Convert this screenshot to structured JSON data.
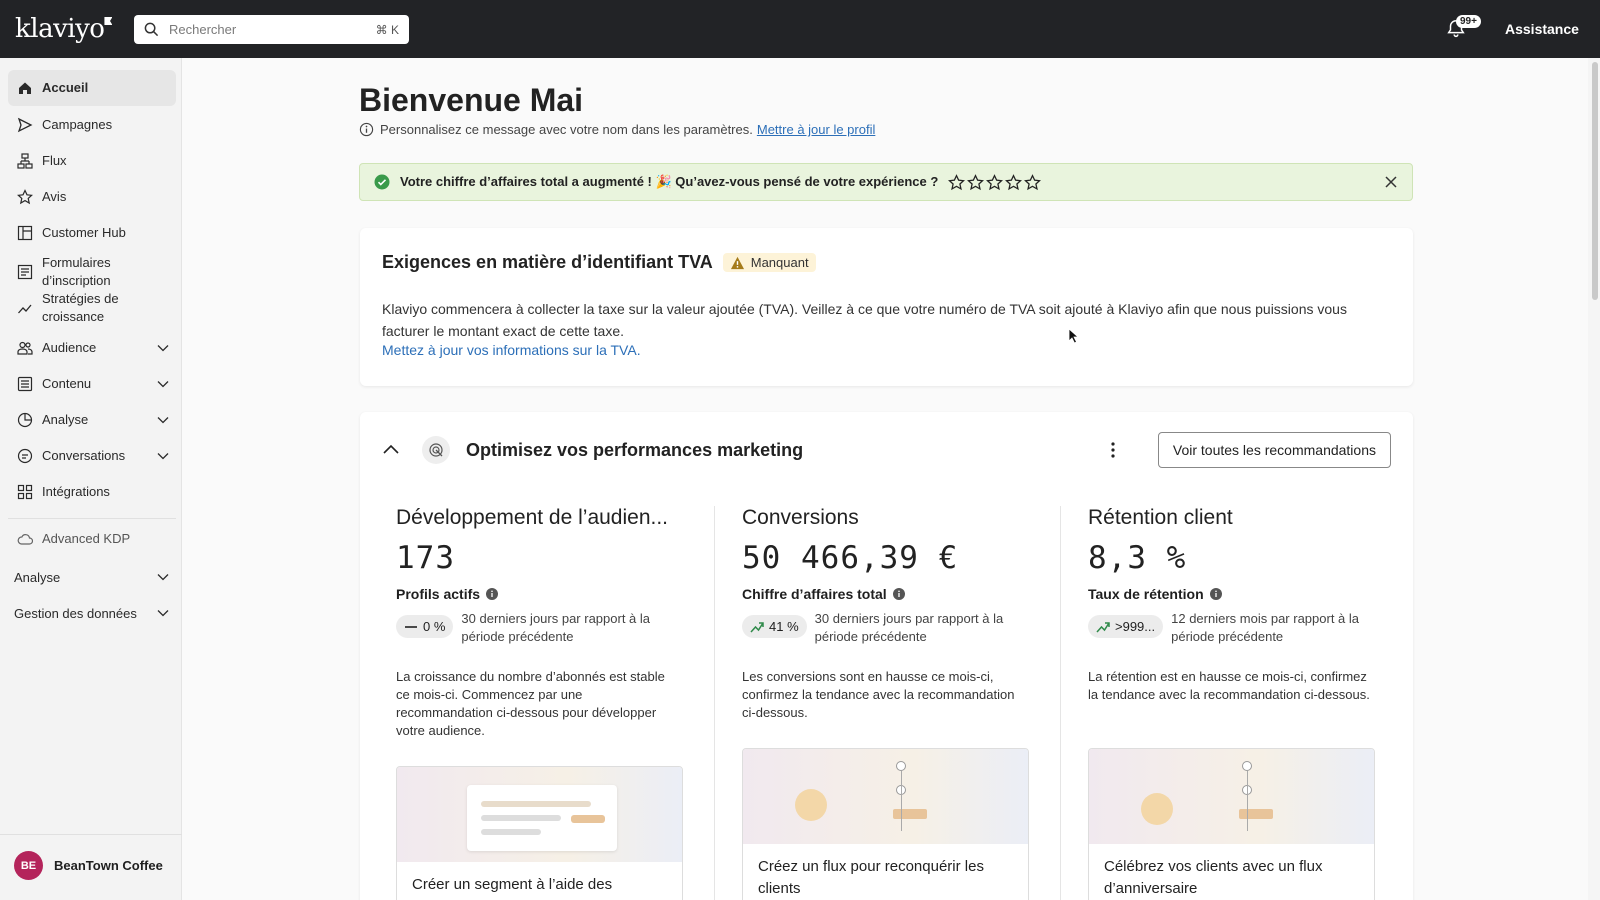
{
  "topbar": {
    "logo": "klaviyo",
    "search_placeholder": "Rechercher",
    "search_shortcut": "⌘ K",
    "notification_badge": "99+",
    "assistance_label": "Assistance"
  },
  "sidebar": {
    "items": [
      {
        "label": "Accueil",
        "icon": "home-icon",
        "active": true
      },
      {
        "label": "Campagnes",
        "icon": "send-icon"
      },
      {
        "label": "Flux",
        "icon": "flow-icon"
      },
      {
        "label": "Avis",
        "icon": "star-icon"
      },
      {
        "label": "Customer Hub",
        "icon": "hub-icon"
      },
      {
        "label": "Formulaires d’inscription",
        "icon": "form-icon"
      },
      {
        "label": "Stratégies de croissance",
        "icon": "growth-icon"
      },
      {
        "label": "Audience",
        "icon": "audience-icon",
        "expandable": true
      },
      {
        "label": "Contenu",
        "icon": "content-icon",
        "expandable": true
      },
      {
        "label": "Analyse",
        "icon": "analytics-icon",
        "expandable": true
      },
      {
        "label": "Conversations",
        "icon": "chat-icon",
        "expandable": true
      },
      {
        "label": "Intégrations",
        "icon": "grid-icon"
      }
    ],
    "advanced_kdp": "Advanced KDP",
    "section_analyse": "Analyse",
    "section_data": "Gestion des données",
    "account_initials": "BE",
    "account_name": "BeanTown Coffee"
  },
  "main": {
    "title": "Bienvenue Mai",
    "subtitle": "Personnalisez ce message avec votre nom dans les paramètres.",
    "subtitle_link": "Mettre à jour le profil",
    "alert_text": "Votre chiffre d’affaires total a augmenté ! 🎉 Qu’avez-vous pensé de votre expérience ?",
    "vat": {
      "title": "Exigences en matière d’identifiant TVA",
      "badge": "Manquant",
      "body": "Klaviyo commencera à collecter la taxe sur la valeur ajoutée (TVA). Veillez à ce que votre numéro de TVA soit ajouté à Klaviyo afin que nous puissions vous facturer le montant exact de cette taxe.",
      "link": "Mettez à jour vos informations sur la TVA."
    },
    "optimize": {
      "title": "Optimisez vos performances marketing",
      "button": "Voir toutes les recommandations",
      "columns": [
        {
          "heading": "Développement de l’audien...",
          "value": "173",
          "metric": "Profils actifs",
          "change": "0 %",
          "period": "30 derniers jours par rapport à la période précédente",
          "description": "La croissance du nombre d’abonnés est stable ce mois-ci. Commencez par une recommandation ci-dessous pour développer votre audience.",
          "card_title": "Créer un segment à l’aide des"
        },
        {
          "heading": "Conversions",
          "value": "50 466,39 €",
          "metric": "Chiffre d’affaires total",
          "change": "41 %",
          "period": "30 derniers jours par rapport à la période précédente",
          "description": "Les conversions sont en hausse ce mois-ci, confirmez la tendance avec la recommandation ci-dessous.",
          "card_title": "Créez un flux pour reconquérir les clients"
        },
        {
          "heading": "Rétention client",
          "value": "8,3 %",
          "metric": "Taux de rétention",
          "change": ">999...",
          "period": "12 derniers mois par rapport à la période précédente",
          "description": "La rétention est en hausse ce mois-ci, confirmez la tendance avec la recommandation ci-dessous.",
          "card_title": "Célébrez vos clients avec un flux d’anniversaire"
        }
      ]
    }
  },
  "colors": {
    "topbar": "#222326",
    "link": "#2c6fb8",
    "success_bg": "#e9f4dd",
    "success_icon": "#3a9a4a",
    "avatar": "#b4245b"
  }
}
